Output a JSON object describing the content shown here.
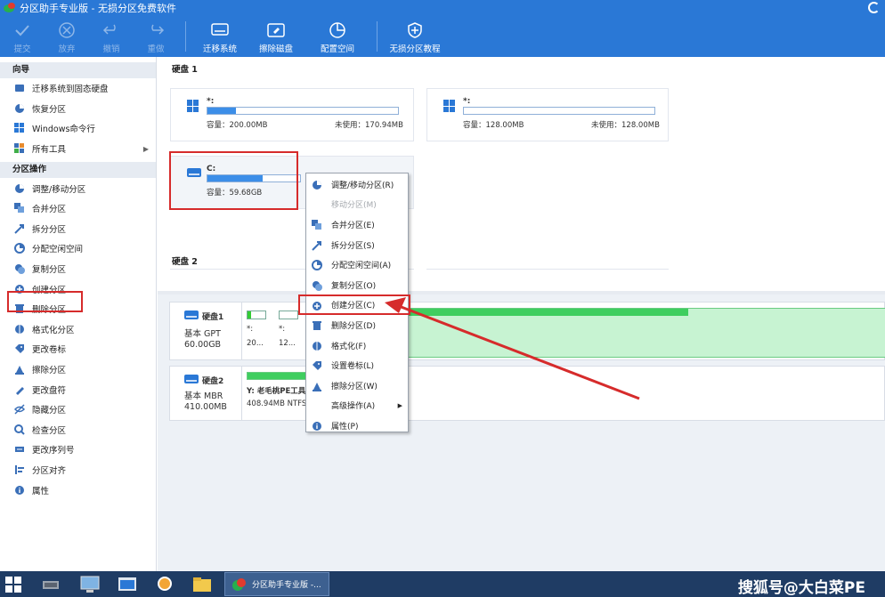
{
  "titlebar": {
    "title": "分区助手专业版 - 无损分区免费软件"
  },
  "toolbar": {
    "items": [
      {
        "label": "提交",
        "icon": "check-icon",
        "enabled": false
      },
      {
        "label": "放弃",
        "icon": "cancel-icon",
        "enabled": false
      },
      {
        "label": "撤销",
        "icon": "undo-icon",
        "enabled": false
      },
      {
        "label": "重做",
        "icon": "redo-icon",
        "enabled": false
      },
      {
        "label": "迁移系统",
        "icon": "migrate-os-icon",
        "enabled": true
      },
      {
        "label": "擦除磁盘",
        "icon": "wipe-disk-icon",
        "enabled": true
      },
      {
        "label": "配置空间",
        "icon": "allocate-space-icon",
        "enabled": true
      },
      {
        "label": "无损分区教程",
        "icon": "tutorial-icon",
        "enabled": true
      }
    ]
  },
  "sidebar": {
    "wizard_header": "向导",
    "wizard_items": [
      {
        "label": "迁移系统到固态硬盘",
        "icon": "ssd-migrate-icon"
      },
      {
        "label": "恢复分区",
        "icon": "recover-partition-icon"
      },
      {
        "label": "Windows命令行",
        "icon": "windows-icon"
      },
      {
        "label": "所有工具",
        "icon": "all-tools-icon",
        "submenu": "▶"
      }
    ],
    "ops_header": "分区操作",
    "ops_items": [
      {
        "label": "调整/移动分区",
        "icon": "resize-move-icon"
      },
      {
        "label": "合并分区",
        "icon": "merge-icon"
      },
      {
        "label": "拆分分区",
        "icon": "split-icon"
      },
      {
        "label": "分配空闲空间",
        "icon": "allocate-free-icon"
      },
      {
        "label": "复制分区",
        "icon": "copy-partition-icon"
      },
      {
        "label": "创建分区",
        "icon": "create-partition-icon"
      },
      {
        "label": "删除分区",
        "icon": "delete-partition-icon"
      },
      {
        "label": "格式化分区",
        "icon": "format-icon"
      },
      {
        "label": "更改卷标",
        "icon": "label-icon"
      },
      {
        "label": "擦除分区",
        "icon": "wipe-partition-icon"
      },
      {
        "label": "更改盘符",
        "icon": "drive-letter-icon"
      },
      {
        "label": "隐藏分区",
        "icon": "hide-icon"
      },
      {
        "label": "检查分区",
        "icon": "check-partition-icon"
      },
      {
        "label": "更改序列号",
        "icon": "serial-icon"
      },
      {
        "label": "分区对齐",
        "icon": "align-icon"
      },
      {
        "label": "属性",
        "icon": "info-icon"
      }
    ]
  },
  "main": {
    "disk1_label": "硬盘 1",
    "disk2_label": "硬盘 2",
    "cards": [
      {
        "drive": "*:",
        "capacity": "容量：200.00MB",
        "free": "未使用：170.94MB",
        "used_fraction": 0.15
      },
      {
        "drive": "*:",
        "capacity": "容量：128.00MB",
        "free": "未使用：128.00MB",
        "used_fraction": 0.0
      },
      {
        "drive": "C:",
        "capacity": "容量：59.68GB",
        "used_fraction": 0.6
      }
    ],
    "disk_rows": [
      {
        "name": "硬盘1",
        "type": "基本 GPT",
        "size": "60.00GB",
        "segments": [
          {
            "label": "*:",
            "size": "20..."
          },
          {
            "label": "*:",
            "size": "12..."
          }
        ]
      },
      {
        "name": "硬盘2",
        "type": "基本 MBR",
        "size": "410.00MB",
        "partition_title": "Y: 老毛桃PE工具",
        "partition_info": "408.94MB NTFS"
      }
    ]
  },
  "context_menu": {
    "items": [
      {
        "label": "调整/移动分区(R)",
        "icon": "resize-move-icon",
        "enabled": true
      },
      {
        "label": "移动分区(M)",
        "icon": "",
        "enabled": false
      },
      {
        "label": "合并分区(E)",
        "icon": "merge-icon",
        "enabled": true
      },
      {
        "label": "拆分分区(S)",
        "icon": "split-icon",
        "enabled": true
      },
      {
        "label": "分配空闲空间(A)",
        "icon": "allocate-free-icon",
        "enabled": true
      },
      {
        "label": "复制分区(O)",
        "icon": "copy-partition-icon",
        "enabled": true
      },
      {
        "label": "创建分区(C)",
        "icon": "create-partition-icon",
        "enabled": true
      },
      {
        "label": "删除分区(D)",
        "icon": "delete-partition-icon",
        "enabled": true
      },
      {
        "label": "格式化(F)",
        "icon": "format-icon",
        "enabled": true
      },
      {
        "label": "设置卷标(L)",
        "icon": "label-icon",
        "enabled": true
      },
      {
        "label": "擦除分区(W)",
        "icon": "wipe-partition-icon",
        "enabled": true
      },
      {
        "label": "高级操作(A)",
        "icon": "",
        "enabled": true,
        "submenu": "▶"
      },
      {
        "label": "属性(P)",
        "icon": "info-icon",
        "enabled": true
      }
    ]
  },
  "taskbar": {
    "active_task": "分区助手专业版 -...",
    "watermark": "搜狐号@大白菜PE"
  },
  "colors": {
    "accent": "#2a78d6",
    "highlight": "#d62b2b",
    "bar_fill": "#3c8ee8",
    "green": "#3fce5f"
  }
}
